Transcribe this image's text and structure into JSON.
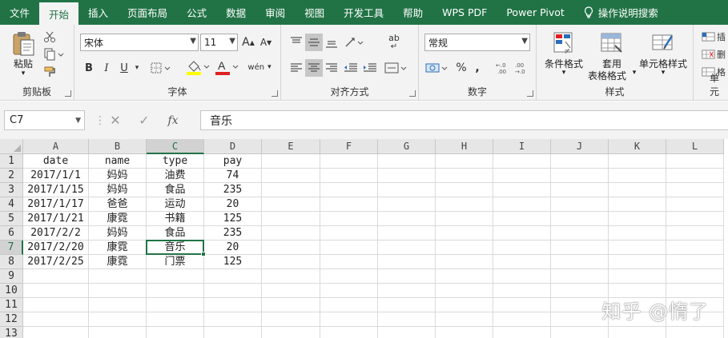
{
  "menu": {
    "items": [
      "文件",
      "开始",
      "插入",
      "页面布局",
      "公式",
      "数据",
      "审阅",
      "视图",
      "开发工具",
      "帮助",
      "WPS PDF",
      "Power Pivot"
    ],
    "active_index": 1,
    "tell_me": "操作说明搜索"
  },
  "ribbon": {
    "clipboard": {
      "paste": "粘贴",
      "label": "剪贴板"
    },
    "font": {
      "name": "宋体",
      "size": "11",
      "grow": "A",
      "shrink": "A",
      "bold": "B",
      "italic": "I",
      "underline": "U",
      "wen": "wén",
      "label": "字体"
    },
    "alignment": {
      "label": "对齐方式",
      "wrap": "ab"
    },
    "number": {
      "format": "常规",
      "percent": "%",
      "comma": ",",
      "label": "数字"
    },
    "styles": {
      "conditional": "条件格式",
      "table_line1": "套用",
      "table_line2": "表格格式",
      "cell_styles": "单元格样式",
      "label": "样式"
    },
    "cells": {
      "label": "单元"
    },
    "colors": {
      "font_color": "#e02020",
      "highlight": "#ffff00",
      "accent": "#217346"
    }
  },
  "formula_bar": {
    "name_box": "C7",
    "cancel": "✕",
    "enter": "✓",
    "fx": "fx",
    "content": "音乐"
  },
  "sheet": {
    "columns": [
      "A",
      "B",
      "C",
      "D",
      "E",
      "F",
      "G",
      "H",
      "I",
      "J",
      "K",
      "L"
    ],
    "row_numbers": [
      "1",
      "2",
      "3",
      "4",
      "5",
      "6",
      "7",
      "8",
      "9",
      "10",
      "11",
      "12",
      "13"
    ],
    "rows": [
      [
        "date",
        "name",
        "type",
        "pay"
      ],
      [
        "2017/1/1",
        "妈妈",
        "油费",
        "74"
      ],
      [
        "2017/1/15",
        "妈妈",
        "食品",
        "235"
      ],
      [
        "2017/1/17",
        "爸爸",
        "运动",
        "20"
      ],
      [
        "2017/1/21",
        "康霓",
        "书籍",
        "125"
      ],
      [
        "2017/2/2",
        "妈妈",
        "食品",
        "235"
      ],
      [
        "2017/2/20",
        "康霓",
        "音乐",
        "20"
      ],
      [
        "2017/2/25",
        "康霓",
        "门票",
        "125"
      ]
    ],
    "active_cell": {
      "col": "C",
      "row": "7"
    }
  },
  "watermark": "知乎 @惰了"
}
